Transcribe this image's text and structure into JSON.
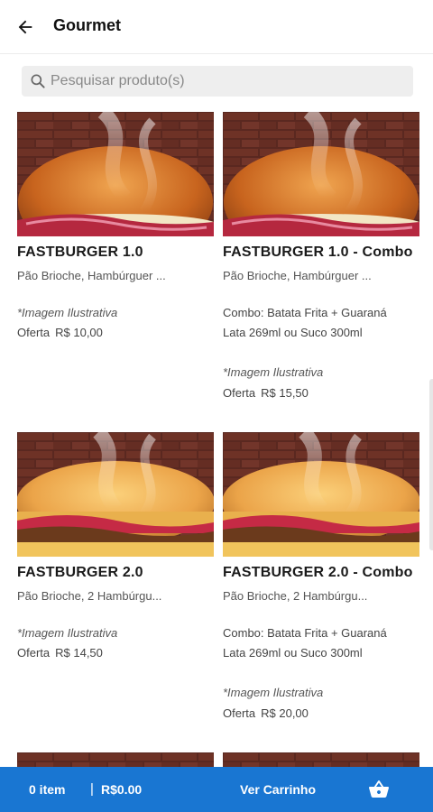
{
  "header": {
    "title": "Gourmet",
    "back_icon": "arrow-left-icon"
  },
  "search": {
    "placeholder": "Pesquisar produto(s)",
    "value": "",
    "icon": "search-icon"
  },
  "products": [
    {
      "name": "FASTBURGER 1.0",
      "description": "Pão Brioche, Hambúrguer ...",
      "combo_line1": "",
      "combo_line2": "",
      "note": "*Imagem Ilustrativa",
      "price_label": "Oferta",
      "price": "R$ 10,00"
    },
    {
      "name": "FASTBURGER 1.0 - Combo",
      "description": "Pão Brioche, Hambúrguer ...",
      "combo_line1": "Combo: Batata Frita + Guaraná",
      "combo_line2": "Lata 269ml ou Suco 300ml",
      "note": "*Imagem Ilustrativa",
      "price_label": "Oferta",
      "price": "R$ 15,50"
    },
    {
      "name": "FASTBURGER 2.0",
      "description": "Pão Brioche, 2 Hambúrgu...",
      "combo_line1": "",
      "combo_line2": "",
      "note": "*Imagem Ilustrativa",
      "price_label": "Oferta",
      "price": "R$ 14,50"
    },
    {
      "name": "FASTBURGER 2.0 - Combo",
      "description": "Pão Brioche, 2 Hambúrgu...",
      "combo_line1": "Combo: Batata Frita + Guaraná",
      "combo_line2": "Lata 269ml ou Suco 300ml",
      "note": "*Imagem Ilustrativa",
      "price_label": "Oferta",
      "price": "R$ 20,00"
    }
  ],
  "cart_bar": {
    "item_count": "0 item",
    "separator": "|",
    "total": "R$0.00",
    "view_cart": "Ver Carrinho",
    "basket_icon": "basket-icon"
  },
  "colors": {
    "primary": "#1976d2",
    "brick": "#5b2a22",
    "bun": "#d9822b",
    "onion": "#b5283f"
  }
}
